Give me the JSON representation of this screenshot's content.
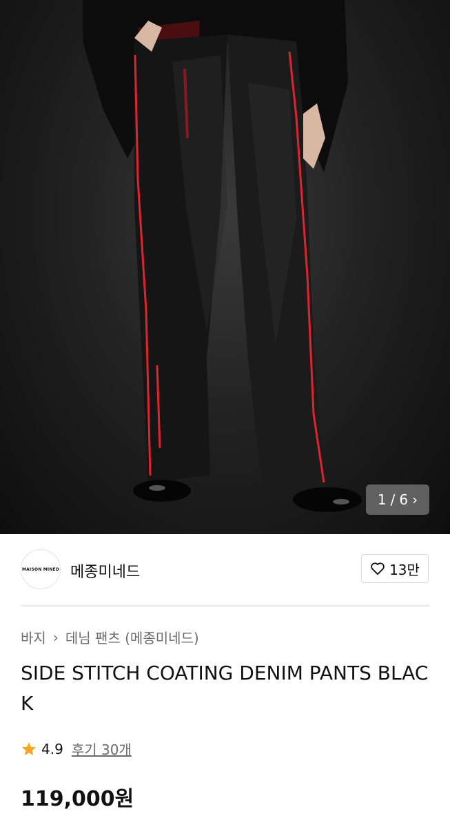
{
  "gallery": {
    "counter_current": "1",
    "counter_separator": "/",
    "counter_total": "6",
    "next_icon": "chevron-right-icon",
    "image_subject": "black coated denim pants with red side stitching"
  },
  "brand": {
    "logo_text": "MAISON MINED",
    "name": "메종미네드",
    "like_icon": "heart-outline-icon",
    "like_count": "13만"
  },
  "breadcrumb": {
    "category": "바지",
    "separator_icon": "chevron-right-icon",
    "subcategory": "데님 팬츠 (메종미네드)"
  },
  "product": {
    "title": "SIDE STITCH COATING DENIM PANTS BLACK",
    "rating_icon": "star-icon",
    "rating": "4.9",
    "reviews": "후기 30개",
    "price": "119,000원"
  },
  "colors": {
    "star": "#F5A623",
    "stitch": "#E0242F",
    "counter_bg": "#6E6E6E"
  }
}
